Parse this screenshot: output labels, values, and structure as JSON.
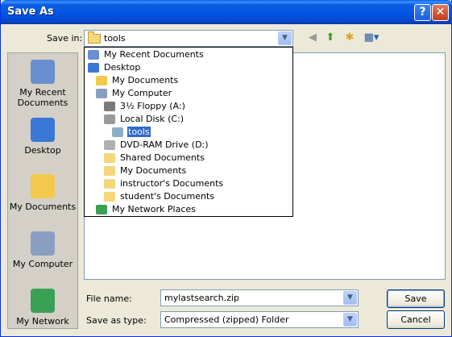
{
  "window": {
    "title": "Save As",
    "help_glyph": "?",
    "close_glyph": "✕"
  },
  "save_in": {
    "label": "Save in:",
    "value": "tools"
  },
  "toolbar_icons": [
    "back-arrow-icon",
    "up-folder-icon",
    "new-folder-icon",
    "views-menu-icon"
  ],
  "places": [
    {
      "label": "My Recent Documents",
      "icon": "recent-documents-icon",
      "color": "#6a8fd0"
    },
    {
      "label": "Desktop",
      "icon": "desktop-icon",
      "color": "#3a78d8"
    },
    {
      "label": "My Documents",
      "icon": "my-documents-icon",
      "color": "#f2c94c"
    },
    {
      "label": "My Computer",
      "icon": "my-computer-icon",
      "color": "#8a9fbf"
    },
    {
      "label": "My Network",
      "icon": "my-network-icon",
      "color": "#3aa055"
    }
  ],
  "dropdown_items": [
    {
      "label": "My Recent Documents",
      "icon": "recent-documents-icon",
      "color": "#6a8fd0"
    },
    {
      "label": "Desktop",
      "icon": "desktop-icon",
      "color": "#3a78d8"
    },
    {
      "label": "My Documents",
      "icon": "my-documents-icon",
      "color": "#f2c94c"
    },
    {
      "label": "My Computer",
      "icon": "my-computer-icon",
      "color": "#8a9fbf"
    },
    {
      "label": "3½ Floppy (A:)",
      "icon": "floppy-drive-icon",
      "color": "#7b7b7b"
    },
    {
      "label": "Local Disk (C:)",
      "icon": "hard-disk-icon",
      "color": "#9a9a9a"
    },
    {
      "label": "tools",
      "icon": "open-folder-icon",
      "color": "#8ab0c8",
      "selected": true
    },
    {
      "label": "DVD-RAM Drive (D:)",
      "icon": "dvd-drive-icon",
      "color": "#b0b0b0"
    },
    {
      "label": "Shared Documents",
      "icon": "folder-icon",
      "color": "#f5d67a"
    },
    {
      "label": "My Documents",
      "icon": "folder-icon",
      "color": "#f5d67a"
    },
    {
      "label": "instructor's Documents",
      "icon": "folder-icon",
      "color": "#f5d67a"
    },
    {
      "label": "student's Documents",
      "icon": "folder-icon",
      "color": "#f5d67a"
    },
    {
      "label": "My Network Places",
      "icon": "network-places-icon",
      "color": "#3aa055"
    }
  ],
  "file_name": {
    "label": "File name:",
    "value": "mylastsearch.zip"
  },
  "save_as_type": {
    "label": "Save as type:",
    "value": "Compressed (zipped) Folder"
  },
  "buttons": {
    "save": "Save",
    "cancel": "Cancel"
  },
  "colors": {
    "title_bar": "#0054e3",
    "dialog_bg": "#ece9d8",
    "selection": "#316ac5"
  }
}
